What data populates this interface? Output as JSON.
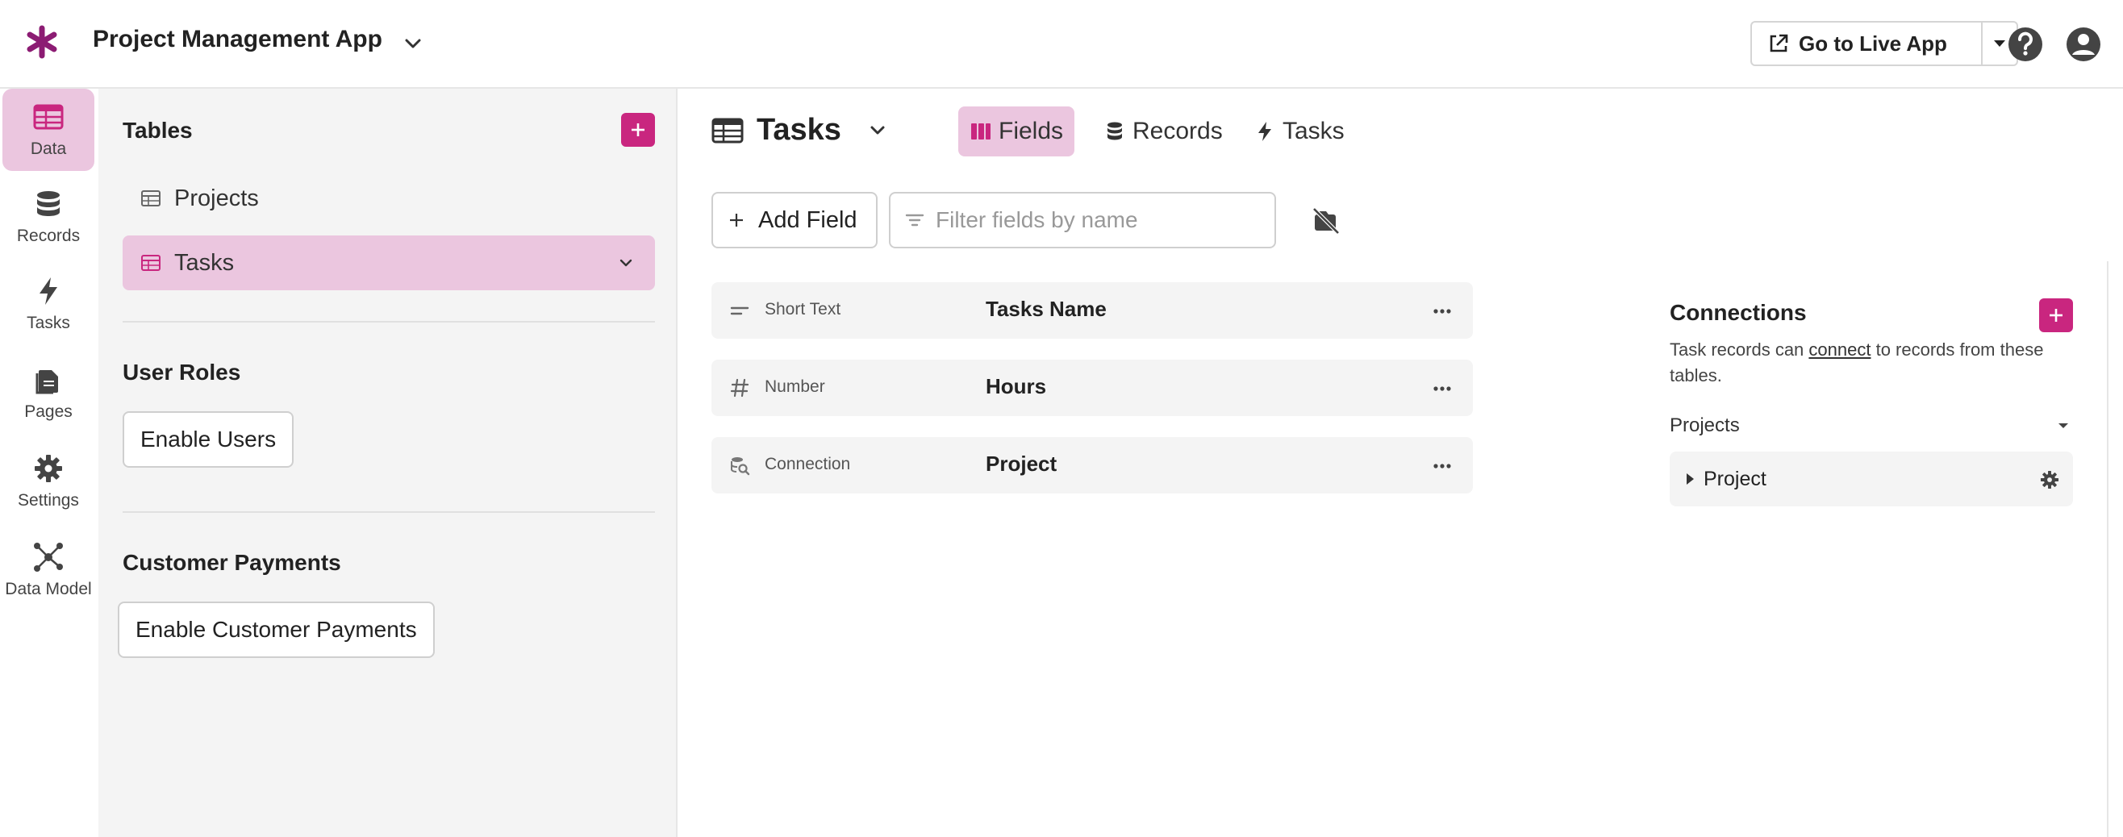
{
  "header": {
    "app_title": "Project Management App",
    "live_app_label": "Go to Live App"
  },
  "nav": {
    "items": [
      {
        "label": "Data",
        "icon": "table-icon"
      },
      {
        "label": "Records",
        "icon": "database-icon"
      },
      {
        "label": "Tasks",
        "icon": "bolt-icon"
      },
      {
        "label": "Pages",
        "icon": "pages-icon"
      },
      {
        "label": "Settings",
        "icon": "gear-icon"
      },
      {
        "label": "Data Model",
        "icon": "network-icon"
      }
    ],
    "active": "Data"
  },
  "sidebar": {
    "tables_title": "Tables",
    "tables": [
      {
        "label": "Projects"
      },
      {
        "label": "Tasks"
      }
    ],
    "selected_table": "Tasks",
    "user_roles_title": "User Roles",
    "enable_users_label": "Enable Users",
    "payments_title": "Customer Payments",
    "enable_payments_label": "Enable Customer Payments"
  },
  "main": {
    "table_title": "Tasks",
    "tabs": [
      {
        "label": "Fields",
        "icon": "columns-icon"
      },
      {
        "label": "Records",
        "icon": "database-icon"
      },
      {
        "label": "Tasks",
        "icon": "bolt-icon"
      }
    ],
    "active_tab": "Fields",
    "add_field_label": "Add Field",
    "filter_placeholder": "Filter fields by name",
    "fields": [
      {
        "type": "Short Text",
        "name": "Tasks Name",
        "icon": "short-text-icon"
      },
      {
        "type": "Number",
        "name": "Hours",
        "icon": "hash-icon"
      },
      {
        "type": "Connection",
        "name": "Project",
        "icon": "connection-icon"
      }
    ]
  },
  "connections": {
    "title": "Connections",
    "desc_before": "Task records can ",
    "desc_link": "connect",
    "desc_after": " to records from these tables.",
    "group_label": "Projects",
    "items": [
      {
        "label": "Project"
      }
    ]
  },
  "colors": {
    "accent": "#c9267f",
    "accent_light": "#ebc6df",
    "brand_logo": "#8c1c73"
  }
}
